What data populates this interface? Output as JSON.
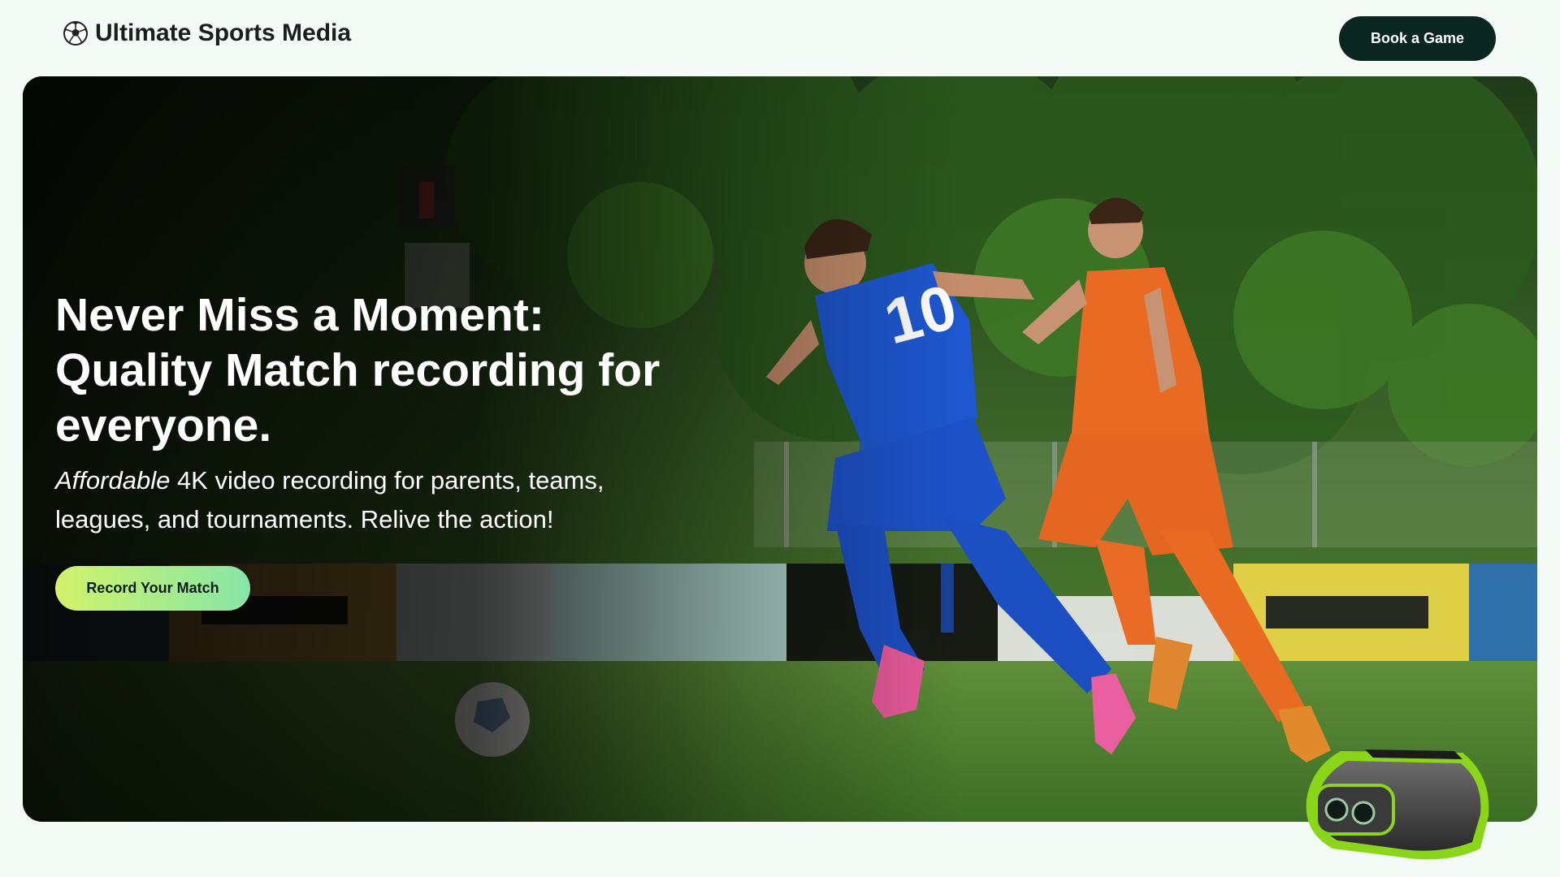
{
  "header": {
    "brand": "Ultimate Sports Media",
    "brand_icon": "soccer-ball-icon",
    "cta_label": "Book a Game"
  },
  "hero": {
    "title": "Never Miss a Moment: Quality Match recording for everyone.",
    "subtitle_emphasis": "Affordable",
    "subtitle_rest": " 4K video recording for parents, teams, leagues, and tournaments. Relive the action!",
    "cta_label": "Record Your Match",
    "cta_gradient": [
      "#d2f36a",
      "#86e6a6"
    ],
    "player_left_number": "10"
  },
  "colors": {
    "page_bg": "#f4faf5",
    "dark_button": "#0a2620",
    "brand_text": "#1a1f1c"
  }
}
